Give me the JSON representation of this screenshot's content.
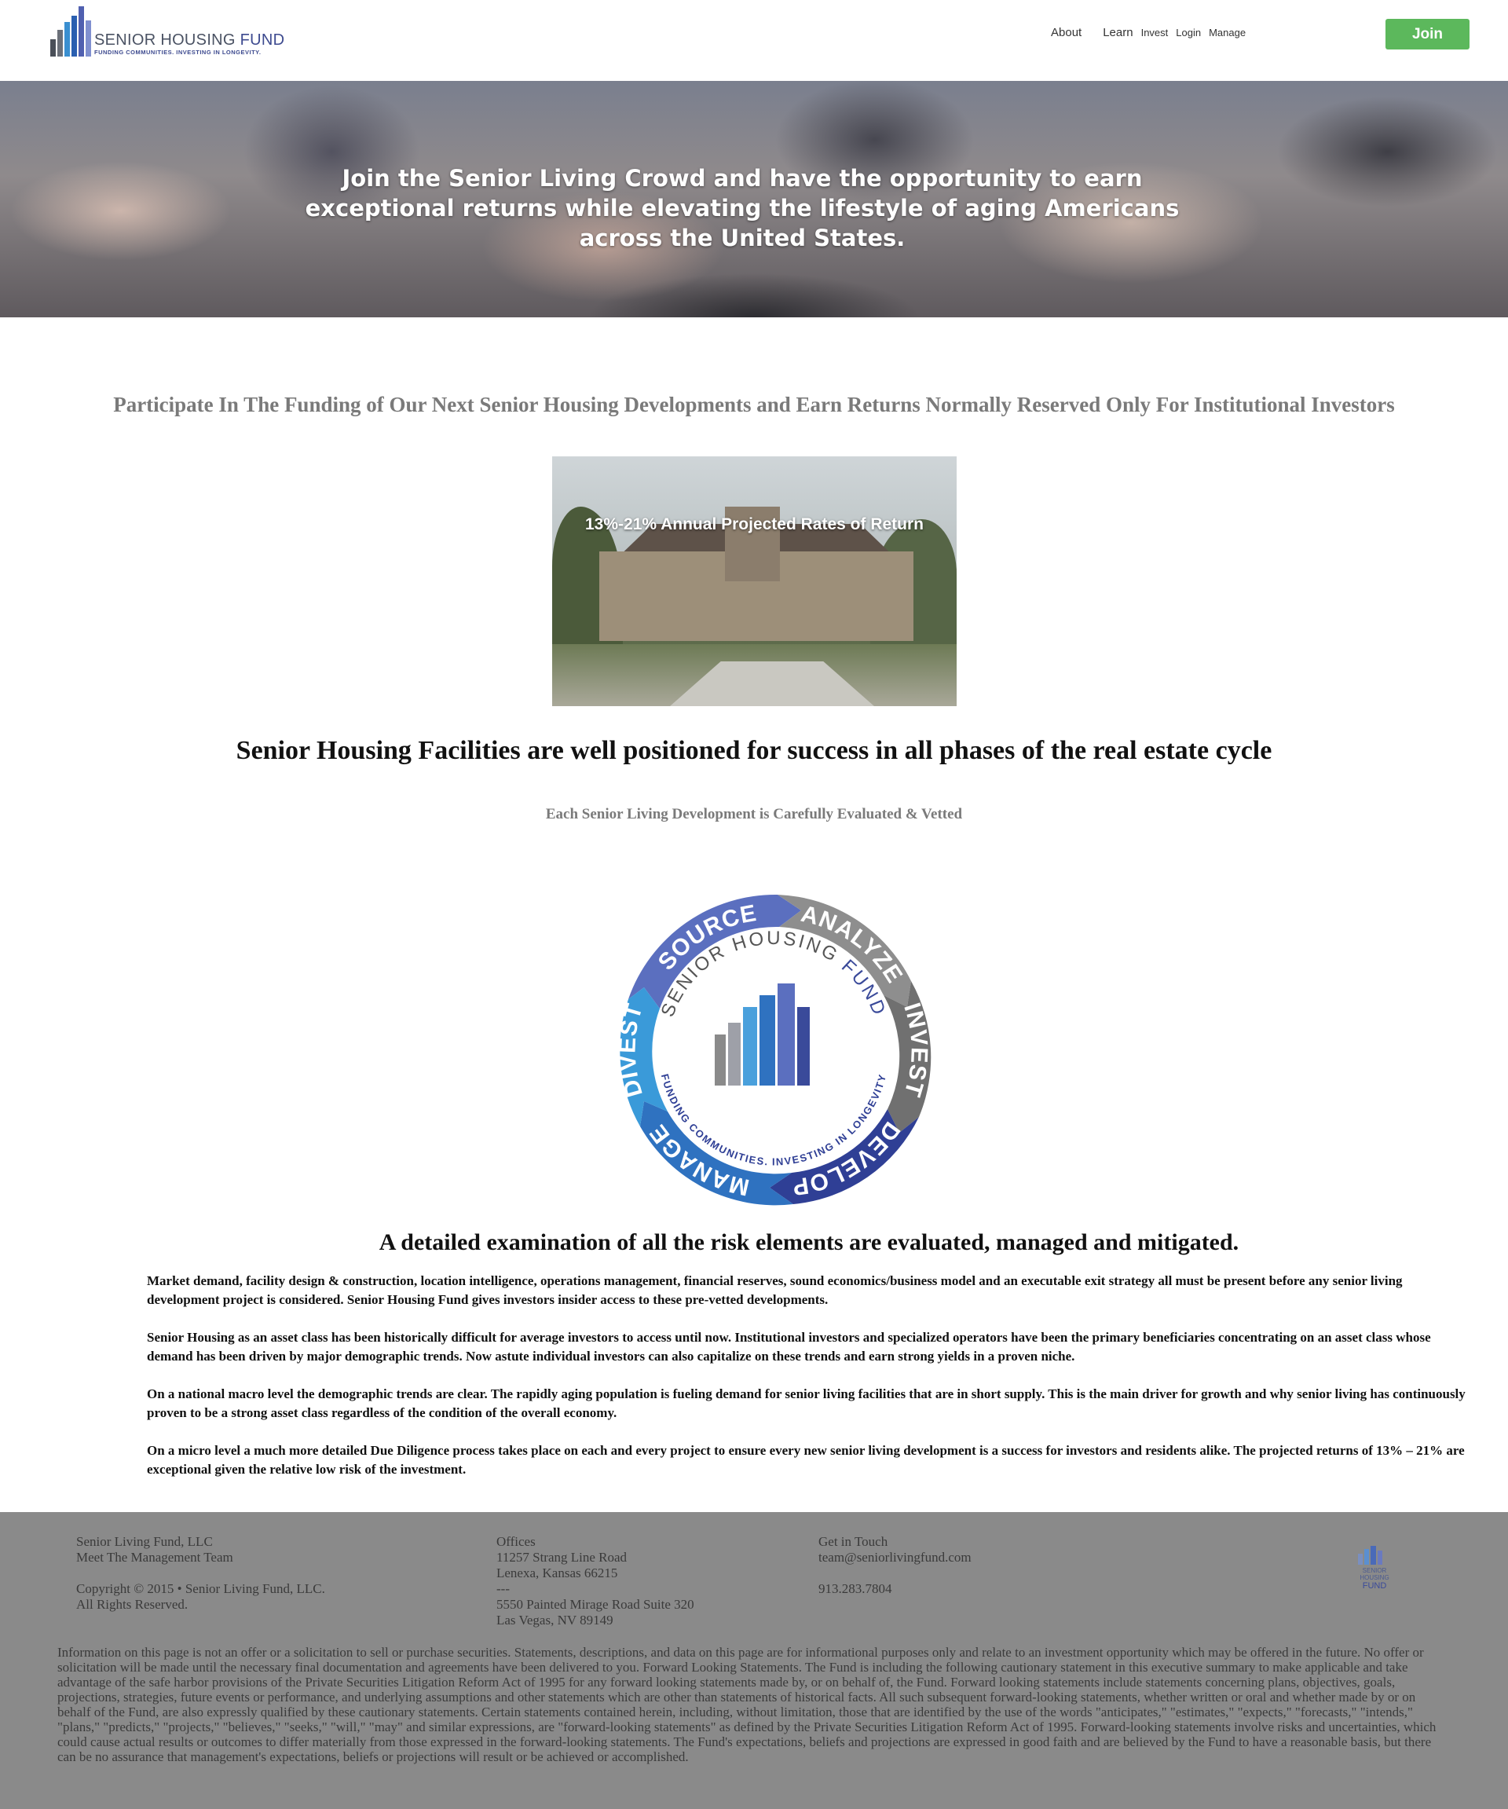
{
  "header": {
    "logo": {
      "name_part1": "SENIOR HOUSING",
      "name_part2": "FUND",
      "tagline": "FUNDING COMMUNITIES. INVESTING IN LONGEVITY."
    },
    "nav": {
      "about": "About",
      "learn": "Learn",
      "invest": "Invest",
      "login": "Login",
      "manage": "Manage"
    },
    "join_label": "Join"
  },
  "hero": {
    "text": "Join the Senior Living Crowd and have the opportunity to earn exceptional returns while elevating the lifestyle of aging Americans across the United States."
  },
  "main": {
    "lead": "Participate In The Funding of Our Next Senior Housing Developments and Earn Returns Normally Reserved Only For Institutional Investors",
    "photo_caption": "13%-21% Annual Projected Rates of Return",
    "heading": "Senior Housing Facilities are well positioned for success in all phases of the real estate cycle",
    "subheading": "Each Senior Living Development is Carefully Evaluated & Vetted",
    "cycle": {
      "segments": [
        "SOURCE",
        "ANALYZE",
        "INVEST",
        "DEVELOP",
        "MANAGE",
        "DIVEST"
      ],
      "ring_name_1": "SENIOR HOUSING",
      "ring_name_2": "FUND",
      "ring_tagline": "FUNDING COMMUNITIES. INVESTING IN LONGEVITY",
      "colors": {
        "source": "#5b6fbf",
        "analyze": "#8a8a8a",
        "invest": "#6f6f6f",
        "develop": "#2f3f95",
        "manage": "#2f72c0",
        "divest": "#3a9ad9"
      }
    },
    "heading2": "A detailed examination of all the risk elements are evaluated, managed and mitigated.",
    "paragraphs": [
      "Market demand, facility design & construction, location intelligence, operations management,  financial reserves, sound economics/business model and an executable exit strategy all must be present before any senior living development project is considered. Senior Housing Fund gives investors insider access to these pre-vetted developments.",
      "Senior Housing as an asset class has been historically difficult for average investors to access until now. Institutional investors and specialized operators have been the primary beneficiaries concentrating on an asset class whose demand has been driven by major demographic trends.  Now astute individual investors can also capitalize on these trends and earn strong yields in a proven niche.",
      "On a national macro level the demographic trends are clear. The rapidly aging population is fueling demand for senior living facilities that are in short supply. This is the main driver for growth and why senior living has continuously proven to be a strong asset class regardless of the condition of the overall economy.",
      "On a micro level a much more detailed Due Diligence process takes place on each and every project to ensure every new senior living development is a success for investors and residents alike.  The projected returns of 13% – 21% are exceptional given the relative low risk of the investment."
    ]
  },
  "footer": {
    "company": "Senior Living Fund, LLC",
    "team_link": "Meet The Management Team",
    "copyright": "Copyright © 2015 • Senior Living Fund, LLC.",
    "rights": "All Rights Reserved.",
    "offices_label": "Offices",
    "office1_line1": "11257 Strang Line Road",
    "office1_line2": "Lenexa, Kansas 66215",
    "separator": "---",
    "office2_line1": "5550 Painted Mirage Road Suite 320",
    "office2_line2": "Las Vegas, NV 89149",
    "contact_label": "Get in Touch",
    "email": "team@seniorlivingfund.com",
    "phone": "913.283.7804",
    "logo_name1": "SENIOR",
    "logo_name2": "HOUSING",
    "logo_name3": "FUND",
    "disclaimer": "Information on this page is not an offer or a solicitation to sell or purchase securities. Statements, descriptions, and data on this page are for informational purposes only and relate to an investment opportunity which may be offered in the future. No offer or solicitation will be made until the necessary final documentation and agreements have been delivered to you. Forward Looking Statements. The Fund is including the following cautionary statement in this executive summary to make applicable and take advantage of the safe harbor provisions of the Private Securities Litigation Reform Act of 1995 for any forward looking statements made by, or on behalf of, the Fund. Forward looking statements include statements concerning plans, objectives, goals, projections, strategies, future events or performance, and underlying assumptions and other statements which are other than statements of historical facts. All such subsequent forward-looking statements, whether written or oral and whether made by or on behalf of the Fund, are also expressly qualified by these cautionary statements. Certain statements contained herein, including, without limitation, those that are identified by the use of the words \"anticipates,\" \"estimates,\" \"expects,\" \"forecasts,\" \"intends,\" \"plans,\" \"predicts,\" \"projects,\" \"believes,\" \"seeks,\" \"will,\" \"may\" and similar expressions, are \"forward-looking statements\" as defined by the Private Securities Litigation Reform Act of 1995. Forward-looking statements involve risks and uncertainties, which could cause actual results or outcomes to differ materially from those expressed in the forward-looking statements. The Fund's expectations, beliefs and projections are expressed in good faith and are believed by the Fund to have a reasonable basis, but there can be no assurance that management's expectations, beliefs or projections will result or be achieved or accomplished."
  }
}
